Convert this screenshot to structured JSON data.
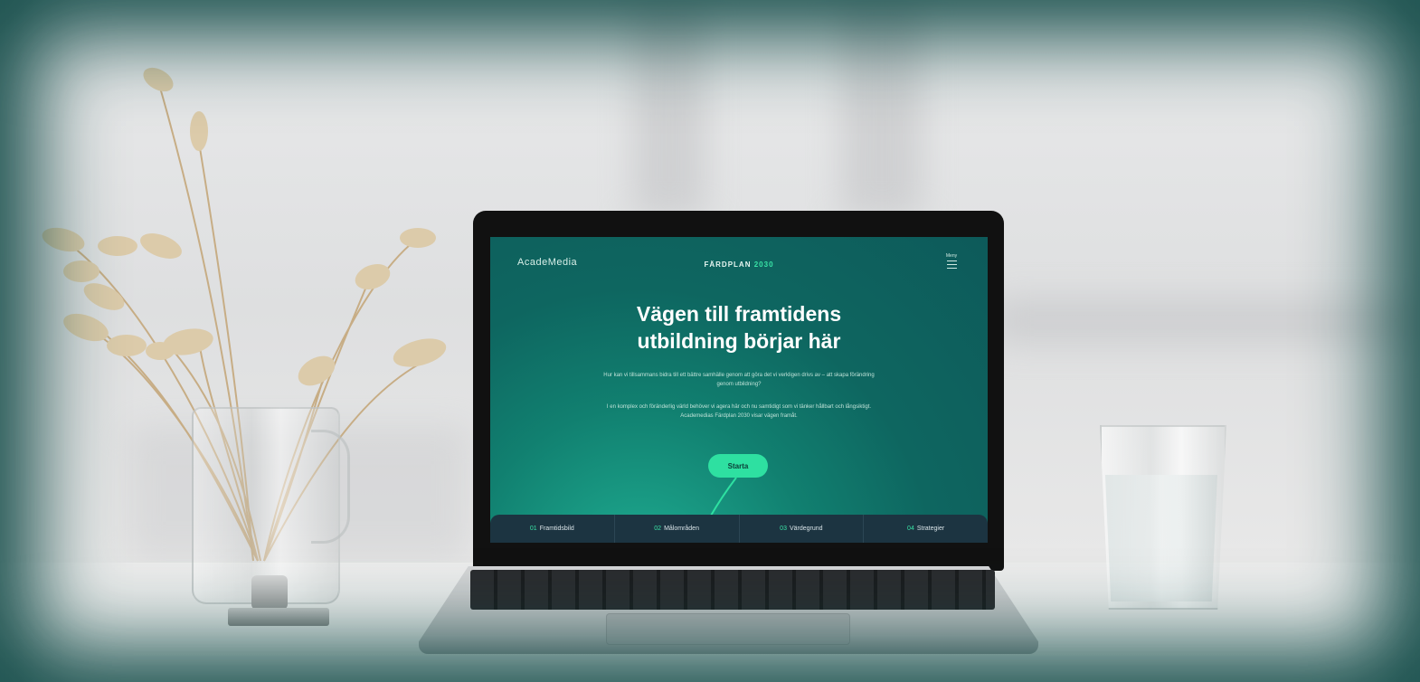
{
  "site": {
    "logo": "AcadeMedia",
    "brand_word": "FÄRDPLAN",
    "brand_year": "2030",
    "menu_label": "Meny"
  },
  "hero": {
    "title_line1": "Vägen till framtidens",
    "title_line2": "utbildning börjar här",
    "para1": "Hur kan vi tillsammans bidra till ett bättre samhälle genom att göra det vi verkligen drivs av – att skapa förändring genom utbildning?",
    "para2": "I en komplex och föränderlig värld behöver vi agera här och nu samtidigt som vi tänker hållbart och långsiktigt. Academedias Färdplan 2030 visar vägen framåt.",
    "cta_label": "Starta"
  },
  "nav": [
    {
      "num": "01",
      "label": "Framtidsbild"
    },
    {
      "num": "02",
      "label": "Målområden"
    },
    {
      "num": "03",
      "label": "Värdegrund"
    },
    {
      "num": "04",
      "label": "Strategier"
    }
  ],
  "colors": {
    "accent": "#2ee0a1",
    "screen_bg": "#0e6660",
    "nav_bg": "#1c3441",
    "frame": "#0f4a47"
  }
}
